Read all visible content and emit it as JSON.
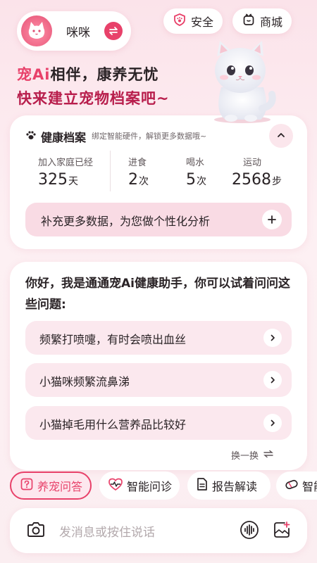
{
  "header": {
    "pet_name": "咪咪",
    "safety_label": "安全",
    "shop_label": "商城"
  },
  "slogan": {
    "line1_highlight": "宠Ai",
    "line1_rest": "相伴，康养无忧",
    "line2": "快来建立宠物档案吧~"
  },
  "health": {
    "title": "健康档案",
    "subtitle": "绑定智能硬件，解锁更多数据哦~",
    "stats": [
      {
        "label": "加入家庭已经",
        "value": "325",
        "unit": "天"
      },
      {
        "label": "进食",
        "value": "2",
        "unit": "次"
      },
      {
        "label": "喝水",
        "value": "5",
        "unit": "次"
      },
      {
        "label": "运动",
        "value": "2568",
        "unit": "步"
      }
    ],
    "supplement": "补充更多数据，为您做个性化分析"
  },
  "assistant": {
    "greeting": "你好，我是通通宠Ai健康助手，你可以试着问问这些问题:",
    "questions": [
      "频繁打喷嚏，有时会喷出血丝",
      "小猫咪频繁流鼻涕",
      "小猫掉毛用什么营养品比较好"
    ],
    "refresh": "换一换"
  },
  "tabs": [
    "养宠问答",
    "智能问诊",
    "报告解读",
    "智能"
  ],
  "input": {
    "placeholder": "发消息或按住说话"
  },
  "colors": {
    "accent": "#e8416a",
    "dark_accent": "#b81e4c",
    "bg_pink": "#fbe3ea"
  }
}
